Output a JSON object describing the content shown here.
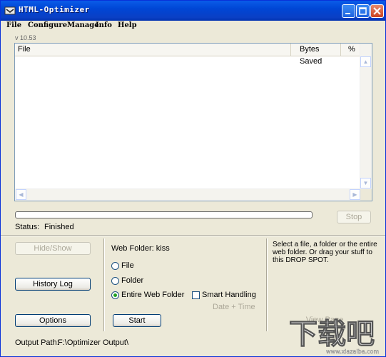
{
  "window": {
    "title": "HTML-Optimizer"
  },
  "menu": [
    "File",
    "Configure",
    "Manage",
    "Info",
    "Help"
  ],
  "version": "v 10.53",
  "list": {
    "columns": [
      "File",
      "Bytes Saved",
      "%"
    ],
    "rows": []
  },
  "progress": {
    "fraction": 0.0
  },
  "stop_label": "Stop",
  "status": {
    "label": "Status:",
    "value": "Finished"
  },
  "left_buttons": {
    "hide_show": "Hide/Show",
    "history_log": "History Log",
    "options": "Options"
  },
  "web_folder_label": "Web Folder: kiss",
  "radios": {
    "file": "File",
    "folder": "Folder",
    "entire": "Entire Web Folder",
    "selected": "entire"
  },
  "smart_handling": "Smart Handling",
  "date_time": "Date + Time",
  "start_label": "Start",
  "help_text": "Select a file, a folder or the entire web folder. Or drag your stuff to this DROP SPOT.",
  "view_page": "View Page",
  "output": {
    "label": "Output Path:",
    "value": "F:\\Optimizer Output\\"
  },
  "watermark": {
    "text": "下载吧",
    "url": "www.xiazaiba.com"
  }
}
